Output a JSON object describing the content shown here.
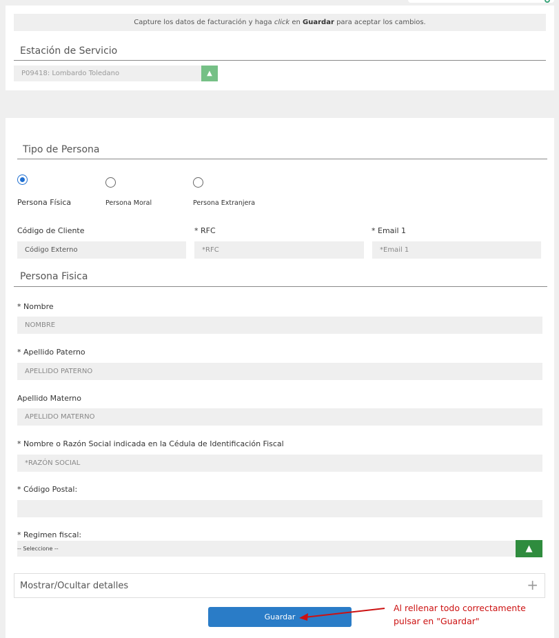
{
  "notice": {
    "part1": "Capture los datos de facturación y haga ",
    "part2": "click",
    "part3": " en ",
    "part4": "Guardar",
    "part5": " para aceptar los cambios."
  },
  "station": {
    "title": "Estación de Servicio",
    "selected": "P09418: Lombardo Toledano"
  },
  "tipo_persona": {
    "title": "Tipo de Persona",
    "options": [
      {
        "label": "Persona Física",
        "checked": true
      },
      {
        "label": "Persona Moral",
        "checked": false
      },
      {
        "label": "Persona Extranjera",
        "checked": false
      }
    ]
  },
  "fields": {
    "codigo_cliente": {
      "label": "Código de Cliente",
      "value": "Código Externo"
    },
    "rfc": {
      "label": "* RFC",
      "placeholder": "*RFC"
    },
    "email": {
      "label": "* Email 1",
      "placeholder": "*Email 1"
    }
  },
  "persona_fisica": {
    "title": "Persona Fisica",
    "nombre": {
      "label": "* Nombre",
      "placeholder": "NOMBRE"
    },
    "apellido_paterno": {
      "label": "* Apellido Paterno",
      "placeholder": "APELLIDO PATERNO"
    },
    "apellido_materno": {
      "label": "Apellido Materno",
      "placeholder": "APELLIDO MATERNO"
    },
    "razon_social": {
      "label": "* Nombre o Razón Social indicada en la Cédula de Identificación Fiscal",
      "placeholder": "*RAZÓN SOCIAL"
    },
    "codigo_postal": {
      "label": "* Código Postal:",
      "placeholder": ""
    },
    "regimen_fiscal": {
      "label": "* Regimen fiscal:",
      "selected": "-- Seleccione --"
    }
  },
  "details": {
    "label": "Mostrar/Ocultar detalles"
  },
  "save_button": {
    "label": "Guardar"
  },
  "annotation": {
    "line1": "Al rellenar todo correctamente",
    "line2": "pulsar en \"Guardar\""
  },
  "colors": {
    "accent": "#2a7cc7",
    "select_button": "#76c086",
    "regimen_button": "#2f8c3e",
    "annotation": "#cc1111"
  },
  "icons": [
    "chevron-updown-icon",
    "plus-icon",
    "arrow-annotation-icon"
  ]
}
